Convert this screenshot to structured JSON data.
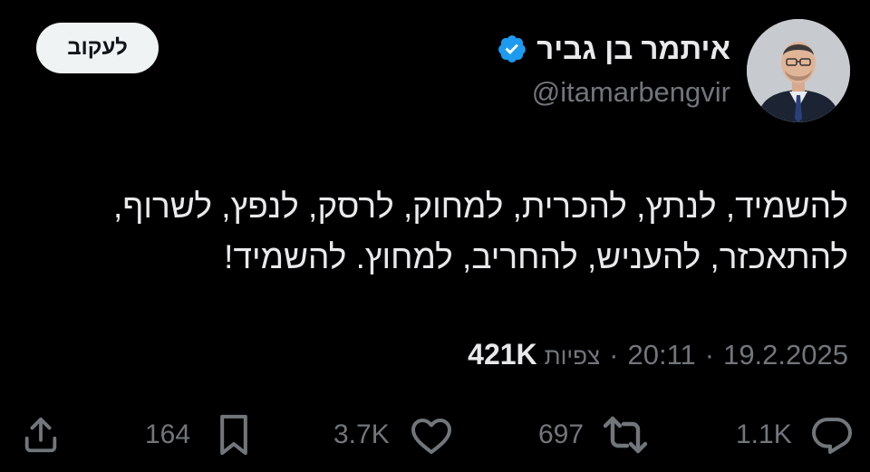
{
  "author": {
    "display_name": "איתמר בן גביר",
    "handle": "@itamarbengvir",
    "verified_icon": "verified-badge-icon",
    "verified_color": "#1d9bf0"
  },
  "follow_button": {
    "label": "לעקוב"
  },
  "tweet": {
    "lines": [
      "להשמיד, לנתץ, להכרית, למחוק, לרסק, לנפץ, לשרוף,",
      "להתאכזר, להעניש, להחריב, למחוץ. להשמיד!"
    ]
  },
  "meta": {
    "date": "19.2.2025",
    "separator": "·",
    "time": "20:11",
    "views_label": "צפיות",
    "views_count": "421K"
  },
  "actions": {
    "reply": {
      "icon": "reply-icon",
      "count": "1.1K"
    },
    "retweet": {
      "icon": "retweet-icon",
      "count": "697"
    },
    "like": {
      "icon": "heart-icon",
      "count": "3.7K"
    },
    "bookmark": {
      "icon": "bookmark-icon",
      "count": "164"
    },
    "share": {
      "icon": "share-icon"
    }
  },
  "colors": {
    "background": "#000000",
    "primary_text": "#e7e9ea",
    "secondary_text": "#71767b",
    "follow_button_bg": "#eff3f4"
  }
}
